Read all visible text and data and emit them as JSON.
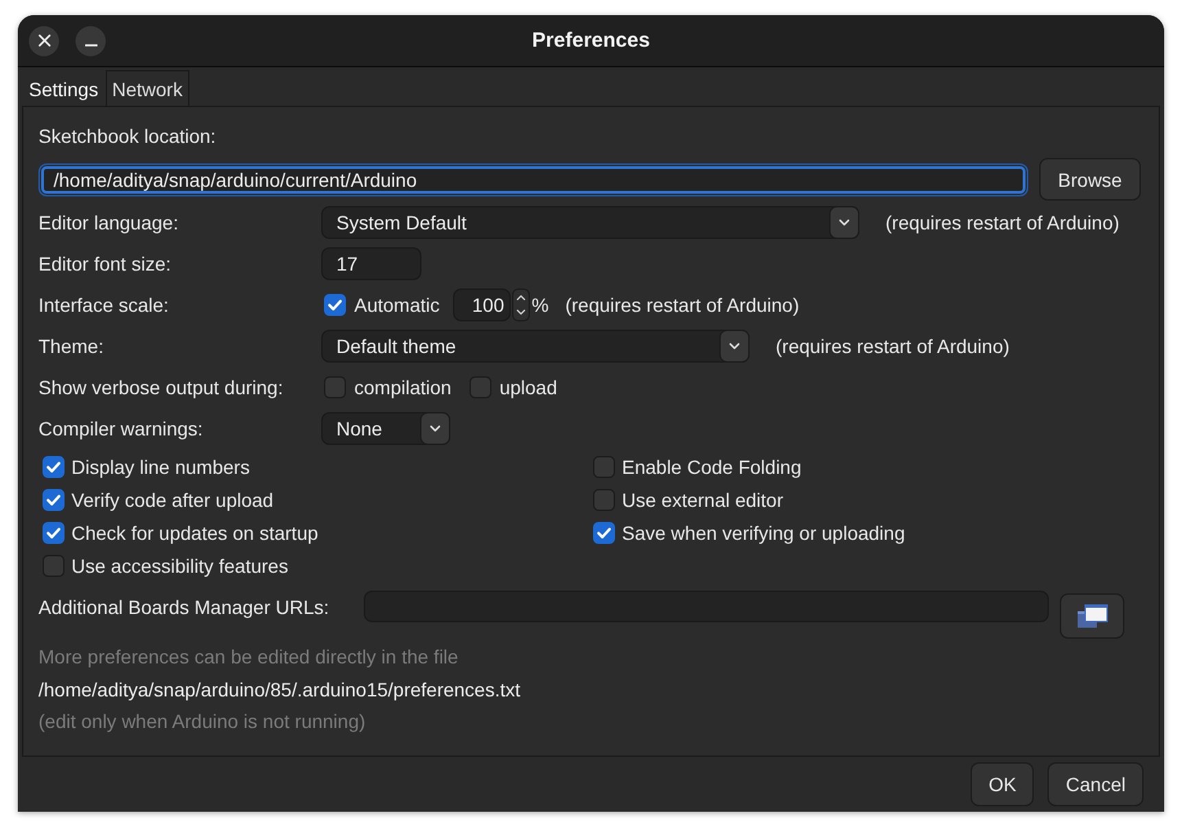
{
  "window": {
    "title": "Preferences",
    "controls": [
      {
        "kind": "close"
      },
      {
        "kind": "minimize"
      }
    ]
  },
  "tabs": [
    {
      "label": "Settings",
      "selected": true
    },
    {
      "label": "Network",
      "selected": false
    }
  ],
  "sketchbook": {
    "label": "Sketchbook location:",
    "value": "/home/aditya/snap/arduino/current/Arduino",
    "focused": true,
    "button": "Browse"
  },
  "rows": [
    {
      "kind": "dropdown",
      "label": "Editor language:",
      "value": "System Default",
      "note": "(requires restart of Arduino)"
    },
    {
      "kind": "text",
      "label": "Editor font size:",
      "value": "17"
    },
    {
      "kind": "scale",
      "label": "Interface scale:",
      "checkbox": {
        "label": "Automatic",
        "checked": true
      },
      "value": "100",
      "unit": "%",
      "note": "(requires restart of Arduino)"
    },
    {
      "kind": "dropdown",
      "label": "Theme:",
      "value": "Default theme",
      "note": "(requires restart of Arduino)"
    },
    {
      "kind": "checks",
      "label": "Show verbose output during:",
      "options": [
        {
          "label": "compilation",
          "checked": false
        },
        {
          "label": "upload",
          "checked": false
        }
      ]
    },
    {
      "kind": "dropdown",
      "label": "Compiler warnings:",
      "value": "None"
    }
  ],
  "option_columns": [
    [
      {
        "label": "Display line numbers",
        "checked": true
      },
      {
        "label": "Verify code after upload",
        "checked": true
      },
      {
        "label": "Check for updates on startup",
        "checked": true
      },
      {
        "label": "Use accessibility features",
        "checked": false
      }
    ],
    [
      {
        "label": "Enable Code Folding",
        "checked": false
      },
      {
        "label": "Use external editor",
        "checked": false
      },
      {
        "label": "Save when verifying or uploading",
        "checked": true
      }
    ]
  ],
  "boards_urls": {
    "label": "Additional Boards Manager URLs:"
  },
  "footer_notes": [
    {
      "kind": "hint",
      "text": "More preferences can be edited directly in the file"
    },
    {
      "kind": "path",
      "text": "/home/aditya/snap/arduino/85/.arduino15/preferences.txt"
    },
    {
      "kind": "hint",
      "text": "(edit only when Arduino is not running)"
    }
  ],
  "buttons": [
    "OK",
    "Cancel"
  ]
}
